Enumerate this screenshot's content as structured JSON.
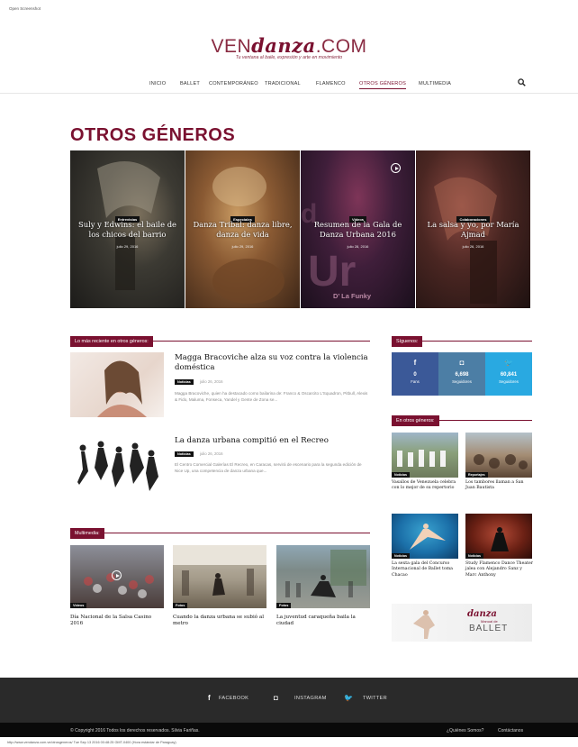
{
  "browser": {
    "top_note": "Open Screenshot",
    "url_note": "http://www.vendanza.com.ve/otrosgeneros/ Tue Sep 13 2016 00:48:25 GMT-0400 (Hora estándar de Paraguay)"
  },
  "logo": {
    "part1": "VEN",
    "part2": "danza",
    "part3": ".COM",
    "tagline": "Tu ventana al baile, expresión y arte en movimiento"
  },
  "nav": {
    "items": [
      "INICIO",
      "BALLET",
      "CONTEMPORÁNEO",
      "TRADICIONAL",
      "FLAMENCO",
      "OTROS GÉNEROS",
      "MULTIMEDIA"
    ],
    "active_index": 5,
    "search_icon": "search-icon"
  },
  "page_title": "OTROS GÉNEROS",
  "hero": [
    {
      "category": "Entrevistas",
      "title": "Suly y Edwins: el baile de los chicos del barrio",
      "date": "julio 29, 2016"
    },
    {
      "category": "Especiales",
      "title": "Danza Tribal: danza libre, danza de vida",
      "date": "julio 29, 2016"
    },
    {
      "category": "Videos",
      "title": "Resumen de la Gala de Danza Urbana 2016",
      "date": "julio 28, 2016",
      "image_text": "D’ La Funky"
    },
    {
      "category": "Colaboraciones",
      "title": "La salsa y yo, por María Ajmad",
      "date": "julio 26, 2016"
    }
  ],
  "recent": {
    "heading": "Lo más reciente en otros géneros:",
    "articles": [
      {
        "title": "Magga Bracoviche alza su voz contra la violencia doméstica",
        "badge": "Noticias",
        "date": "julio 26, 2016",
        "excerpt": "Magga Bracoviche, quien ha destacado como bailarina de: Franco & Oscarcito L'Squadron, Pitbull, Alexis & Fido, Maluma, Fonseca, Yandel y Gente de Zona se..."
      },
      {
        "title": "La danza urbana compitió en el Recreo",
        "badge": "Noticias",
        "date": "julio 26, 2016",
        "excerpt": "El Centro Comercial Galerías El Recreo, en Caracas, servirá de escenario para la segunda edición de Nice Up, una competencia de danza urbana que..."
      }
    ]
  },
  "multimedia": {
    "heading": "Multimedia:",
    "items": [
      {
        "category": "Videos",
        "title": "Día Nacional de la Salsa Casino 2016"
      },
      {
        "category": "Fotos",
        "title": "Cuando la danza urbana se subió al metro"
      },
      {
        "category": "Fotos",
        "title": "La juventud caraqueña baila la ciudad"
      }
    ]
  },
  "sidebar": {
    "follow_heading": "Síguenos:",
    "social": [
      {
        "icon": "facebook-icon",
        "glyph": "f",
        "count": "0",
        "label": "Fans",
        "color": "#3b5998"
      },
      {
        "icon": "instagram-icon",
        "glyph": "◘",
        "count": "6,698",
        "label": "Seguidores",
        "color": "#4c7ea5"
      },
      {
        "icon": "twitter-icon",
        "glyph": "🐦",
        "count": "60,841",
        "label": "Seguidores",
        "color": "#29a9e1"
      }
    ],
    "other_heading": "En otros géneros:",
    "items": [
      {
        "category": "Noticias",
        "title": "Vasallos de Venezuela celebra con lo mejor de su repertorio"
      },
      {
        "category": "Reportajes",
        "title": "Los tambores llaman a San Juan Bautista"
      },
      {
        "category": "Noticias",
        "title": "La sexta gala del Concurso Internacional de Ballet toma Chacao"
      },
      {
        "category": "Noticias",
        "title": "Study Flamenco Dance Theater jalea con Alejandro Sanz y Marc Anthony"
      }
    ],
    "ad": {
      "line1": "danza",
      "line2": "Manual de",
      "line3": "BALLET"
    }
  },
  "footer": {
    "links": [
      {
        "icon": "f",
        "label": "FACEBOOK"
      },
      {
        "icon": "◘",
        "label": "INSTAGRAM"
      },
      {
        "icon": "🐦",
        "label": "TWITTER"
      }
    ],
    "copyright": "© Copyright 2016 Todos los derechos reservados. Silvia Fariñas.",
    "bottom_links": [
      "¿Quiénes Somos?",
      "Contáctanos"
    ]
  },
  "colors": {
    "accent": "#7a1130",
    "dark_footer": "#2a2a2a"
  }
}
